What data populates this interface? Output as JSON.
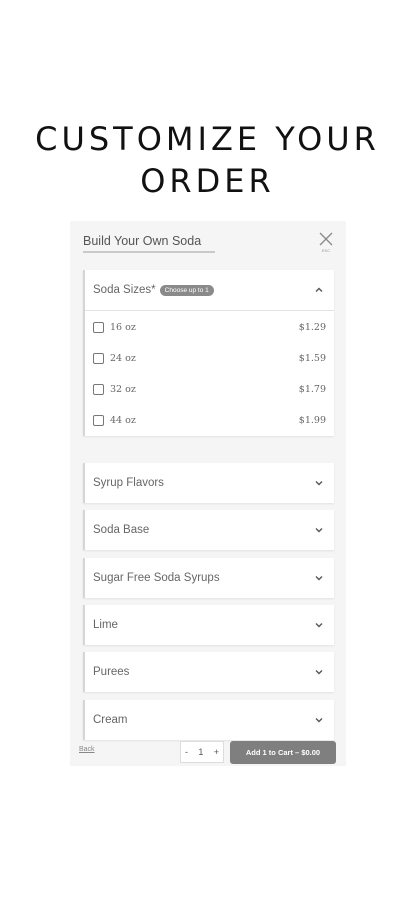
{
  "page": {
    "title": "CUSTOMIZE YOUR ORDER"
  },
  "modal": {
    "title": "Build Your Own Soda",
    "close_label": "ESC"
  },
  "sizes": {
    "label": "Soda Sizes*",
    "badge": "Choose up to 1",
    "options": [
      {
        "name": "16 oz",
        "price": "$1.29"
      },
      {
        "name": "24 oz",
        "price": "$1.59"
      },
      {
        "name": "32 oz",
        "price": "$1.79"
      },
      {
        "name": "44 oz",
        "price": "$1.99"
      }
    ]
  },
  "sections": [
    {
      "label": "Syrup Flavors"
    },
    {
      "label": "Soda Base"
    },
    {
      "label": "Sugar Free Soda Syrups"
    },
    {
      "label": "Lime"
    },
    {
      "label": "Purees"
    },
    {
      "label": "Cream"
    }
  ],
  "footer": {
    "back_label": "Back",
    "quantity": "1",
    "minus": "-",
    "plus": "+",
    "add_label": "Add 1 to Cart – $0.00"
  },
  "colors": {
    "button_bg": "#7f7f7f",
    "badge_bg": "#8a8a8a",
    "modal_bg": "#f5f5f5"
  }
}
